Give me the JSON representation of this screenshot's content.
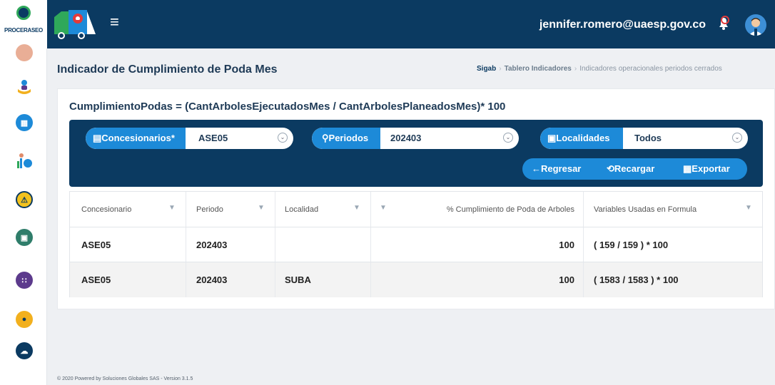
{
  "brand": {
    "name": "PROCERASEO"
  },
  "header": {
    "user_email": "jennifer.romero@uaesp.gov.co",
    "menu_icon": "hamburger-icon",
    "notification_icon": "bell-icon",
    "avatar_icon": "user-avatar-icon"
  },
  "sidebar": {
    "items": [
      {
        "icon": "partial-icon",
        "color": "#e08b6a"
      },
      {
        "icon": "person-hand-icon",
        "color": "#f2b01e"
      },
      {
        "icon": "grid-circle-icon",
        "color": "#1d8ad8"
      },
      {
        "icon": "chart-people-icon",
        "color": "#2fa85a"
      },
      {
        "icon": "clipboard-warning-icon",
        "color": "#f2c21e"
      },
      {
        "icon": "map-circle-icon",
        "color": "#2f7d6a"
      },
      {
        "icon": "apps-circle-icon",
        "color": "#5c3a8c"
      },
      {
        "icon": "bell-circle-icon",
        "color": "#f2b01e"
      },
      {
        "icon": "cloud-circle-icon",
        "color": "#0b3a61"
      }
    ]
  },
  "page": {
    "title": "Indicador de Cumplimiento de Poda Mes",
    "breadcrumb": [
      "Sigab",
      "Tablero Indicadores",
      "Indicadores operacionales periodos cerrados"
    ],
    "formula": "CumplimientoPodas = (CantArbolesEjecutadosMes / CantArbolesPlaneadosMes)* 100"
  },
  "filters": {
    "concesionarios": {
      "label": "Concesionarios*",
      "value": "ASE05",
      "icon": "bus-icon"
    },
    "periodos": {
      "label": "Periodos",
      "value": "202403",
      "icon": "pin-icon"
    },
    "localidades": {
      "label": "Localidades",
      "value": "Todos",
      "icon": "map-square-icon"
    }
  },
  "actions": {
    "regresar": "←Regresar",
    "recargar": "Recargar",
    "exportar": "Exportar"
  },
  "table": {
    "columns": [
      "Concesionario",
      "Periodo",
      "Localidad",
      "% Cumplimiento de Poda de Arboles",
      "Variables Usadas en Formula"
    ],
    "rows": [
      {
        "concesionario": "ASE05",
        "periodo": "202403",
        "localidad": "",
        "cumplimiento": "100",
        "variables": "( 159 / 159 ) * 100"
      },
      {
        "concesionario": "ASE05",
        "periodo": "202403",
        "localidad": "SUBA",
        "cumplimiento": "100",
        "variables": "( 1583 / 1583 ) * 100"
      }
    ]
  },
  "footer": {
    "text": "© 2020 Powered by Soluciones Globales SAS - Version 3.1.5"
  }
}
